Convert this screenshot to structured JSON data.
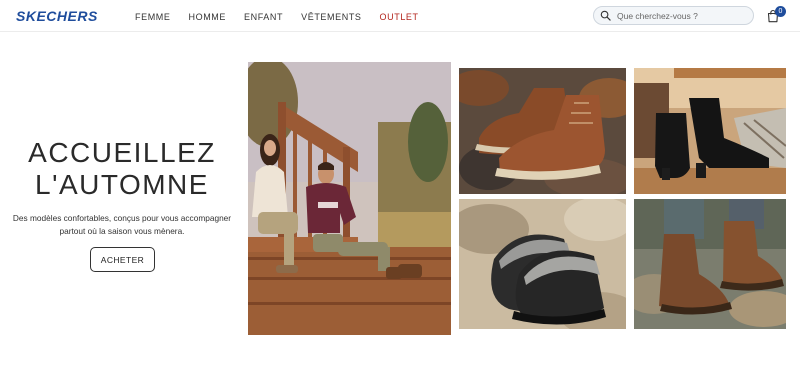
{
  "brand": {
    "logo_text": "SKECHERS",
    "accent": "#1f4d9c"
  },
  "nav": {
    "items": [
      {
        "label": "FEMME"
      },
      {
        "label": "HOMME"
      },
      {
        "label": "ENFANT"
      },
      {
        "label": "VÊTEMENTS"
      },
      {
        "label": "OUTLET",
        "color": "#b3261e"
      }
    ]
  },
  "search": {
    "placeholder": "Que cherchez-vous ?",
    "icon": "search-icon"
  },
  "cart": {
    "icon": "shopping-bag-icon",
    "count": "0"
  },
  "hero": {
    "title_line1": "ACCUEILLEZ",
    "title_line2": "L'AUTOMNE",
    "subtitle_line1": "Des modèles confortables, conçus pour vous accompagner",
    "subtitle_line2": "partout où la saison vous mènera.",
    "cta_label": "ACHETER",
    "main_image": "couple-sitting-on-wooden-porch-autumn",
    "tiles": [
      {
        "image": "brown-leather-ankle-boots-on-leaves"
      },
      {
        "image": "black-heeled-ankle-boots-on-wood"
      },
      {
        "image": "black-fur-lined-slippers-on-rock"
      },
      {
        "image": "brown-lace-up-boots-in-water"
      }
    ]
  }
}
